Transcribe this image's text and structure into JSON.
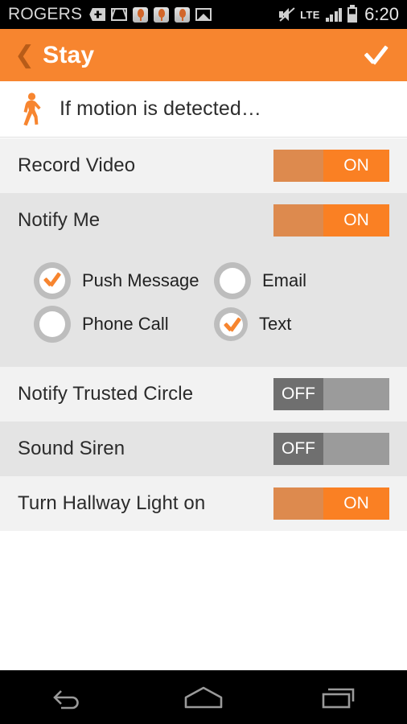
{
  "statusbar": {
    "carrier": "ROGERS",
    "network": "LTE",
    "time": "6:20",
    "icons": [
      "plus-badge-icon",
      "gmail-icon",
      "tree-icon",
      "tree-icon",
      "tree-icon",
      "photo-icon",
      "mute-icon",
      "signal-bars-icon",
      "battery-icon"
    ]
  },
  "appbar": {
    "back_label": "❮",
    "title": "Stay",
    "confirm_label": "confirm-checkmark"
  },
  "trigger": {
    "icon": "walking-person-icon",
    "text": "If motion is detected…"
  },
  "actions": [
    {
      "label": "Record Video",
      "state": "ON",
      "on": true
    },
    {
      "label": "Notify Me",
      "state": "ON",
      "on": true
    },
    {
      "label": "Notify Trusted Circle",
      "state": "OFF",
      "on": false
    },
    {
      "label": "Sound Siren",
      "state": "OFF",
      "on": false
    },
    {
      "label": "Turn Hallway Light on",
      "state": "ON",
      "on": true
    }
  ],
  "notify_options": [
    {
      "label": "Push Message",
      "checked": true
    },
    {
      "label": "Email",
      "checked": false
    },
    {
      "label": "Phone Call",
      "checked": false
    },
    {
      "label": "Text",
      "checked": true
    }
  ],
  "navbar": {
    "back": "back-icon",
    "home": "home-icon",
    "recents": "recents-icon"
  },
  "colors": {
    "accent": "#f7852f",
    "toggle_on_track": "#fa8023",
    "toggle_on_thumb": "#dd8a4e",
    "toggle_off_track": "#9b9b9b",
    "toggle_off_thumb": "#6f6f6f",
    "row_light": "#f2f2f2",
    "row_dark": "#e4e4e4"
  }
}
